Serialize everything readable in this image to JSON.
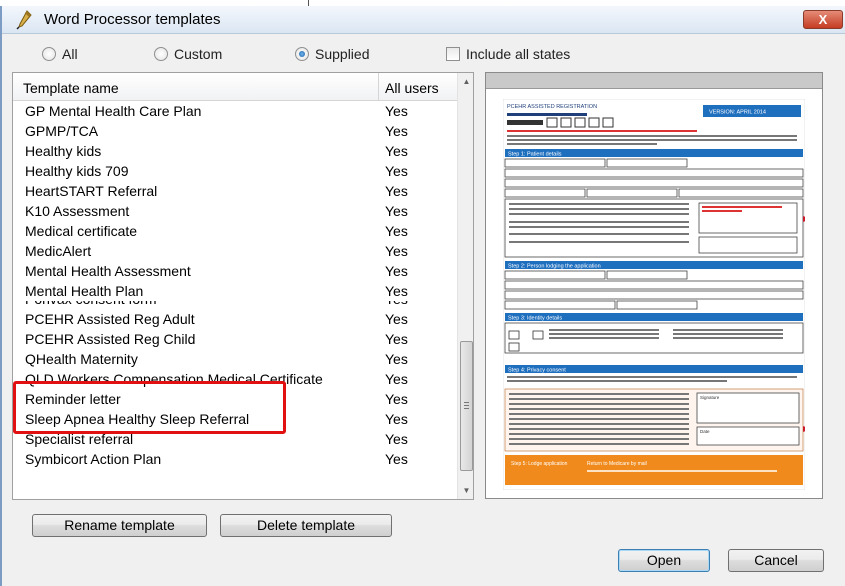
{
  "window": {
    "title": "Word Processor templates",
    "close_label": "X"
  },
  "filter": {
    "options": [
      {
        "label": "All",
        "selected": false
      },
      {
        "label": "Custom",
        "selected": false
      },
      {
        "label": "Supplied",
        "selected": true
      }
    ],
    "include_all_states": {
      "label": "Include all states",
      "checked": false
    }
  },
  "list": {
    "columns": {
      "name": "Template name",
      "users": "All users"
    },
    "rows": [
      {
        "name": "GP Mental Health Care Plan",
        "users": "Yes"
      },
      {
        "name": "GPMP/TCA",
        "users": "Yes"
      },
      {
        "name": "Healthy kids",
        "users": "Yes"
      },
      {
        "name": "Healthy kids 709",
        "users": "Yes"
      },
      {
        "name": "HeartSTART Referral",
        "users": "Yes"
      },
      {
        "name": "K10 Assessment",
        "users": "Yes"
      },
      {
        "name": "Medical certificate",
        "users": "Yes"
      },
      {
        "name": "MedicAlert",
        "users": "Yes"
      },
      {
        "name": "Mental Health Assessment",
        "users": "Yes"
      },
      {
        "name": "Mental Health Plan",
        "users": "Yes"
      },
      {
        "name": "Ponvax consent form",
        "users": "Yes"
      },
      {
        "name": "PCEHR Assisted Reg Adult",
        "users": "Yes"
      },
      {
        "name": "PCEHR Assisted Reg Child",
        "users": "Yes"
      },
      {
        "name": "QHealth Maternity",
        "users": "Yes"
      },
      {
        "name": "QLD Workers Compensation Medical Certificate",
        "users": "Yes"
      },
      {
        "name": "Reminder letter",
        "users": "Yes"
      },
      {
        "name": "Sleep Apnea Healthy Sleep Referral",
        "users": "Yes"
      },
      {
        "name": "Specialist referral",
        "users": "Yes"
      },
      {
        "name": "Symbicort Action Plan",
        "users": "Yes"
      }
    ]
  },
  "preview": {
    "header_left": "PCEHR ASSISTED REGISTRATION",
    "version": "VERSION: APRIL 2014",
    "step1": "Step 1: Patient details",
    "step2": "Step 2: Person lodging the application",
    "step3": "Step 3: Identity details",
    "step4": "Step 4: Privacy consent",
    "signature_label": "Signature",
    "date_label": "Date",
    "footer_left": "Step 5: Lodge application",
    "footer_right": "Return to Medicare by mail"
  },
  "buttons": {
    "rename": "Rename template",
    "delete": "Delete template",
    "open": "Open",
    "cancel": "Cancel"
  },
  "colors": {
    "highlight": "#e11111",
    "doc_accent": "#1f6fbf",
    "doc_footer": "#f08a1c"
  },
  "icons": {
    "app": "pen-nib-icon",
    "close": "close-icon"
  }
}
